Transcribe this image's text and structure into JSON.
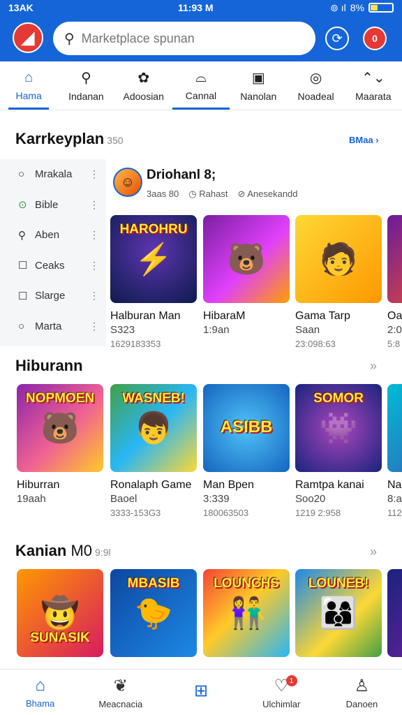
{
  "status_bar": {
    "left": "13AK",
    "time": "11:93 M",
    "battery": "8%"
  },
  "app_bar": {
    "search_placeholder": "Marketplace spunan",
    "notif_badge": "0"
  },
  "tabs": [
    {
      "label": "Hama",
      "icon": "home-icon"
    },
    {
      "label": "Indanan",
      "icon": "link-icon"
    },
    {
      "label": "Adoosian",
      "icon": "puzzle-icon"
    },
    {
      "label": "Cannal",
      "icon": "basket-icon"
    },
    {
      "label": "Nanolan",
      "icon": "square-icon"
    },
    {
      "label": "Noadeal",
      "icon": "search-circle-icon"
    },
    {
      "label": "Maarata",
      "icon": "trend-icon"
    }
  ],
  "marketplace": {
    "title": "Karrkeyplan",
    "count": "350",
    "see_more": "BMaa",
    "filters": [
      {
        "label": "Mrakala",
        "icon": "circle-icon"
      },
      {
        "label": "Bible",
        "icon": "check-circle-icon"
      },
      {
        "label": "Aben",
        "icon": "search-icon"
      },
      {
        "label": "Ceaks",
        "icon": "checkbox-icon"
      },
      {
        "label": "Slarge",
        "icon": "checkbox-icon"
      },
      {
        "label": "Marta",
        "icon": "circle-icon"
      }
    ],
    "developer": {
      "name": "Driohanl 8;",
      "meta1": "3aas 80",
      "meta2": "Rahast",
      "meta3": "Anesekandd"
    },
    "games": [
      {
        "name": "Halburan Man",
        "sub1": "S323",
        "sub2": "1629183353",
        "art_text": "HAROHRU"
      },
      {
        "name": "HibaraM",
        "sub1": "1:9an",
        "sub2": ""
      },
      {
        "name": "Gama Tarp",
        "sub1": "Saan",
        "sub2": "23:098:63"
      },
      {
        "name": "Oa",
        "sub1": "2:0",
        "sub2": "5:8"
      }
    ]
  },
  "hiburan": {
    "title": "Hiburann",
    "games": [
      {
        "name": "Hiburran",
        "sub1": "19aah",
        "sub2": "",
        "art_text": "NOPMOEN"
      },
      {
        "name": "Ronalaph Game",
        "sub1": "Baoel",
        "sub2": "3333-153G3",
        "art_text": "WASNEB!"
      },
      {
        "name": "Man Bpen",
        "sub1": "3:339",
        "sub2": "180063503",
        "art_text": "ASIBB"
      },
      {
        "name": "Ramtpa kanai",
        "sub1": "Soo20",
        "sub2": "1219 2:958",
        "art_text": "SOMOR"
      },
      {
        "name": "Na",
        "sub1": "8:a",
        "sub2": "112"
      }
    ]
  },
  "kanian": {
    "title": "Kanian",
    "title_suffix": "M0",
    "count": "9:9l",
    "games": [
      {
        "art_text": "SUNASIK"
      },
      {
        "art_text": "MBASIB"
      },
      {
        "art_text": "LOUNCHS"
      },
      {
        "art_text": "LOUNEB!"
      }
    ]
  },
  "bottom_nav": [
    {
      "label": "Bhama",
      "icon": "home-icon"
    },
    {
      "label": "Meacnacia",
      "icon": "leaf-icon"
    },
    {
      "label": "",
      "icon": "clipboard-icon"
    },
    {
      "label": "Ulchimlar",
      "icon": "heart-icon",
      "badge": "1"
    },
    {
      "label": "Danoen",
      "icon": "person-icon"
    }
  ]
}
